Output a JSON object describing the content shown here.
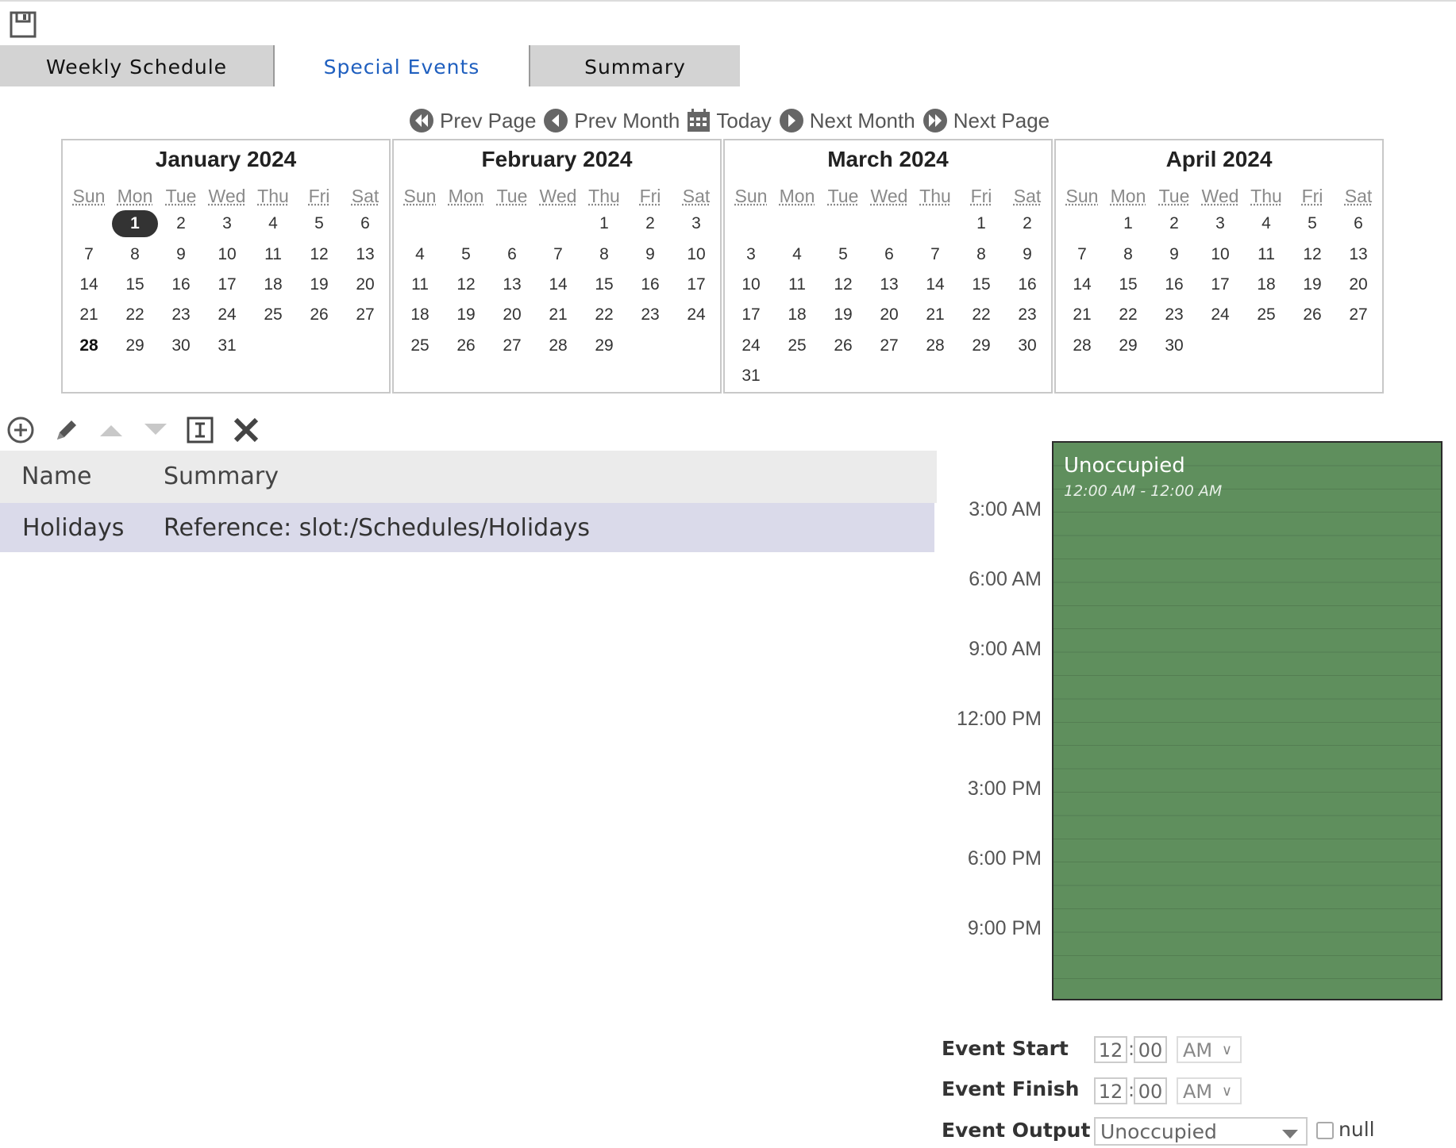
{
  "tabs": [
    {
      "label": "Weekly Schedule"
    },
    {
      "label": "Special Events"
    },
    {
      "label": "Summary"
    }
  ],
  "nav": {
    "prev_page": "Prev Page",
    "prev_month": "Prev Month",
    "today": "Today",
    "next_month": "Next Month",
    "next_page": "Next Page"
  },
  "weekdays": [
    "Sun",
    "Mon",
    "Tue",
    "Wed",
    "Thu",
    "Fri",
    "Sat"
  ],
  "months": [
    {
      "title": "January 2024",
      "first_weekday": 1,
      "days": 31,
      "selected_day": 1,
      "bold_day": 28
    },
    {
      "title": "February 2024",
      "first_weekday": 4,
      "days": 29
    },
    {
      "title": "March 2024",
      "first_weekday": 5,
      "days": 31
    },
    {
      "title": "April 2024",
      "first_weekday": 1,
      "days": 30
    }
  ],
  "toolbar": [
    "add-icon",
    "edit-icon",
    "move-up-icon",
    "move-down-icon",
    "rename-icon",
    "delete-icon"
  ],
  "table": {
    "headers": {
      "name": "Name",
      "summary": "Summary"
    },
    "rows": [
      {
        "name": "Holidays",
        "summary": "Reference: slot:/Schedules/Holidays"
      }
    ]
  },
  "timeline": {
    "labels": [
      "3:00 AM",
      "6:00 AM",
      "9:00 AM",
      "12:00 PM",
      "3:00 PM",
      "6:00 PM",
      "9:00 PM"
    ],
    "event_title": "Unoccupied",
    "event_time": "12:00 AM - 12:00 AM",
    "event_color": "#5f8f5d"
  },
  "event_form": {
    "start_label": "Event Start",
    "finish_label": "Event Finish",
    "output_label": "Event Output",
    "start_hour": "12",
    "start_minute": "00",
    "start_ampm": "AM",
    "finish_hour": "12",
    "finish_minute": "00",
    "finish_ampm": "AM",
    "output_value": "Unoccupied",
    "null_label": "null"
  }
}
